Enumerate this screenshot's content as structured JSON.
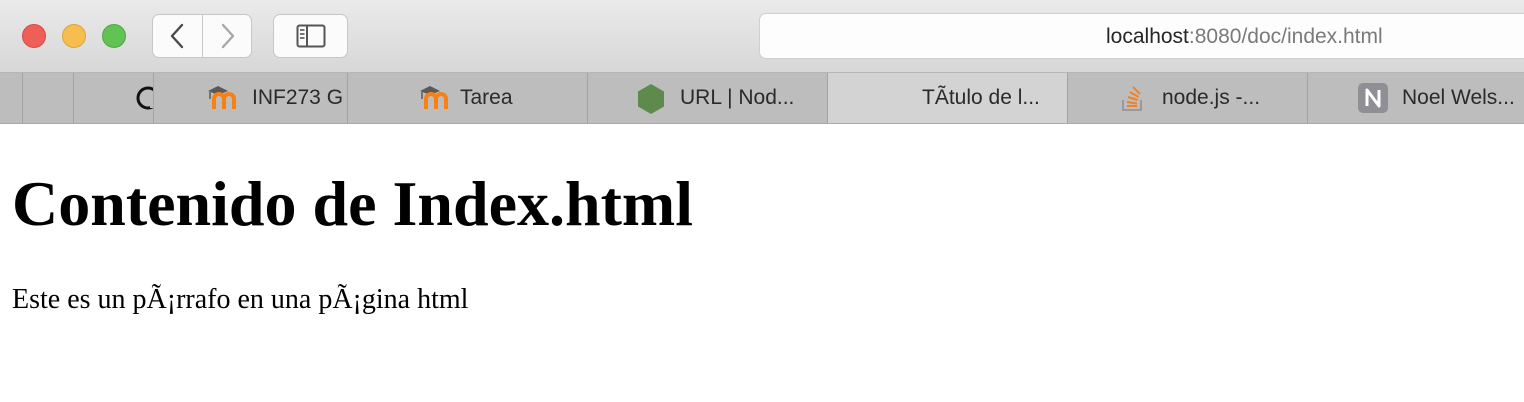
{
  "browser": {
    "address": {
      "host": "localhost",
      "path": ":8080/doc/index.html"
    },
    "tabs": [
      {
        "label": "",
        "icon": "blank"
      },
      {
        "label": "",
        "icon": "github-icon"
      },
      {
        "label": "INF273 G",
        "icon": "moodle-icon"
      },
      {
        "label": "Tarea",
        "icon": "moodle-icon"
      },
      {
        "label": "URL | Nod...",
        "icon": "nodejs-icon"
      },
      {
        "label": "TÃtulo de l...",
        "icon": "none",
        "active": true
      },
      {
        "label": "node.js -...",
        "icon": "stackoverflow-icon"
      },
      {
        "label": "Noel Wels...",
        "icon": "n-letter-icon",
        "icon_text": "N"
      }
    ]
  },
  "page": {
    "heading": "Contenido de Index.html",
    "paragraph": "Este es un pÃ¡rrafo en una pÃ¡gina html"
  },
  "colors": {
    "close": "#ee5f57",
    "minimize": "#f6be4f",
    "zoom": "#61c354",
    "moodle_orange": "#f98012",
    "nodejs_green": "#5f8a4d",
    "stackoverflow_orange": "#f48024"
  }
}
